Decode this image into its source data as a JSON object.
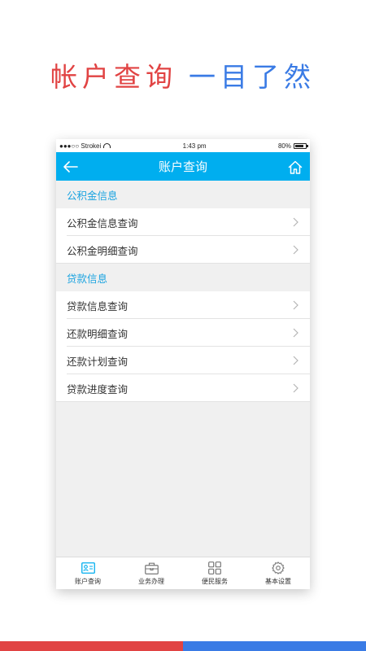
{
  "headline": {
    "part1": "帐户查询",
    "part2": "一目了然"
  },
  "status_bar": {
    "carrier": "●●●○○ Strokei",
    "time": "1:43 pm",
    "battery": "80%",
    "battery_level": 0.8
  },
  "nav": {
    "title": "账户查询",
    "back_icon": "back-arrow-icon",
    "home_icon": "home-icon"
  },
  "sections": [
    {
      "header": "公积金信息",
      "items": [
        {
          "label": "公积金信息查询"
        },
        {
          "label": "公积金明细查询"
        }
      ]
    },
    {
      "header": "贷款信息",
      "items": [
        {
          "label": "贷款信息查询"
        },
        {
          "label": "还款明细查询"
        },
        {
          "label": "还款计划查询"
        },
        {
          "label": "贷款进度查询"
        }
      ]
    }
  ],
  "tabs": [
    {
      "label": "账户查询",
      "icon": "id-card-icon",
      "active": true
    },
    {
      "label": "业务办理",
      "icon": "briefcase-icon",
      "active": false
    },
    {
      "label": "便民服务",
      "icon": "grid-icon",
      "active": false
    },
    {
      "label": "基本设置",
      "icon": "gear-icon",
      "active": false
    }
  ],
  "colors": {
    "accent": "#00aeef",
    "headline_red": "#e14343",
    "headline_blue": "#3a7be5",
    "section_text": "#1aa3e0"
  }
}
